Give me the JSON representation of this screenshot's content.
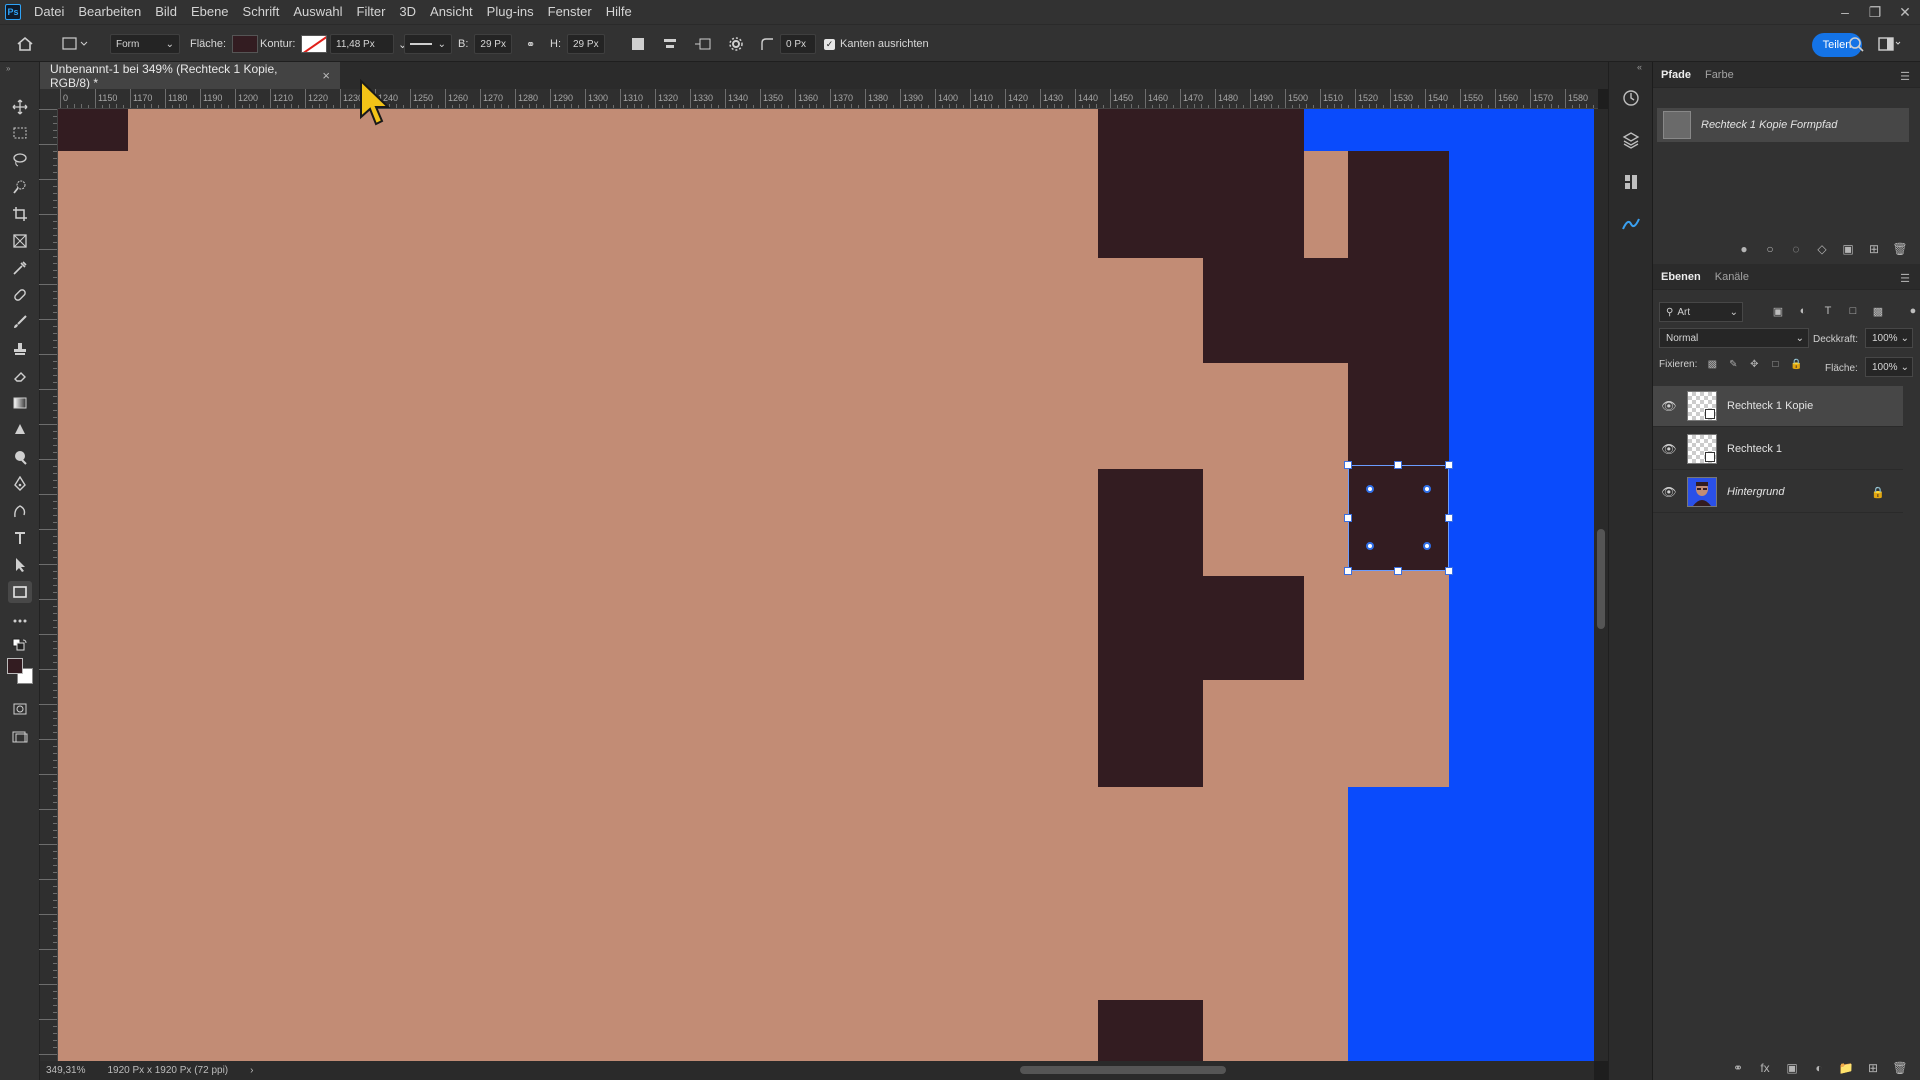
{
  "app": {
    "logo": "Ps"
  },
  "menu": [
    "Datei",
    "Bearbeiten",
    "Bild",
    "Ebene",
    "Schrift",
    "Auswahl",
    "Filter",
    "3D",
    "Ansicht",
    "Plug-ins",
    "Fenster",
    "Hilfe"
  ],
  "options": {
    "mode": "Form",
    "fill_label": "Fläche:",
    "stroke_label": "Kontur:",
    "stroke_width": "11,48 Px",
    "w_label": "B:",
    "w_value": "29 Px",
    "h_label": "H:",
    "h_value": "29 Px",
    "radius": "0 Px",
    "align_edges": "Kanten ausrichten",
    "share": "Teilen",
    "fill_color": "#331c21"
  },
  "document": {
    "tab_title": "Unbenannt-1 bei 349% (Rechteck 1 Kopie, RGB/8) *",
    "zoom": "349,31%",
    "doc_size": "1920 Px x 1920 Px (72 ppi)"
  },
  "ruler": {
    "h_labels": [
      "0",
      "1150",
      "1170",
      "1180",
      "1190",
      "1200",
      "1210",
      "1220",
      "1230",
      "1240",
      "1250",
      "1260",
      "1270",
      "1280",
      "1290",
      "1300",
      "1310",
      "1320",
      "1330",
      "1340",
      "1350",
      "1360",
      "1370",
      "1380",
      "1390",
      "1400",
      "1410",
      "1420",
      "1430",
      "1440",
      "1450",
      "1460",
      "1470",
      "1480",
      "1490",
      "1500",
      "1510",
      "1520",
      "1530",
      "1540",
      "1550",
      "1560",
      "1570",
      "1580"
    ]
  },
  "colors": {
    "canvas_bg": "#c28c75",
    "dark_block": "#331c21",
    "blue": "#0a4bfc",
    "accent": "#1473e6"
  },
  "paths_panel": {
    "tabs": [
      "Pfade",
      "Farbe"
    ],
    "active_tab": "Pfade",
    "path_name": "Rechteck 1 Kopie Formpfad"
  },
  "layers_panel": {
    "tabs": [
      "Ebenen",
      "Kanäle"
    ],
    "filter": "Art",
    "blend_mode": "Normal",
    "opacity_label": "Deckkraft:",
    "opacity": "100%",
    "lock_label": "Fixieren:",
    "fill_label": "Fläche:",
    "fill": "100%",
    "layers": [
      {
        "name": "Rechteck 1 Kopie",
        "selected": true,
        "italic": false,
        "locked": false
      },
      {
        "name": "Rechteck 1",
        "selected": false,
        "italic": false,
        "locked": false
      },
      {
        "name": "Hintergrund",
        "selected": false,
        "italic": true,
        "locked": true
      }
    ]
  }
}
